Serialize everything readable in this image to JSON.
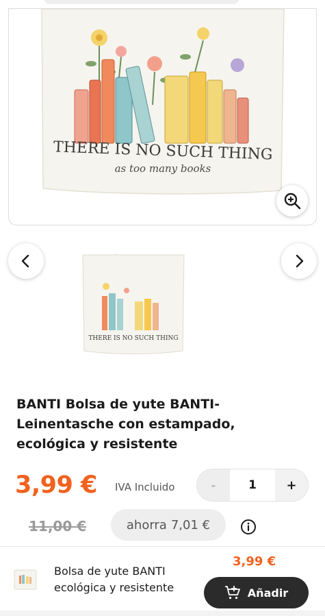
{
  "product": {
    "image_text": "THERE IS NO SUCH THING",
    "image_subtext": "as too many books",
    "title": "BANTI Bolsa de yute BANTI-Leinentasche con estampado, ecológica y resistente"
  },
  "pricing": {
    "price": "3,99 €",
    "vat_label": "IVA Incluido",
    "old_price": "11,00 €",
    "saving_label": "ahorra",
    "saving_amount": "7,01 €"
  },
  "quantity": {
    "minus": "-",
    "value": "1",
    "plus": "+"
  },
  "sticky_bar": {
    "name": "Bolsa de yute BANTI ecológica y resistente",
    "price": "3,99 €",
    "add_label": "Añadir"
  },
  "icons": {
    "zoom": "zoom-in-icon",
    "prev": "chevron-left-icon",
    "next": "chevron-right-icon",
    "info": "info-icon",
    "cart": "cart-add-icon"
  },
  "colors": {
    "accent": "#f2611e",
    "button_dark": "#2b2b2b",
    "muted": "#9a9a9a"
  }
}
